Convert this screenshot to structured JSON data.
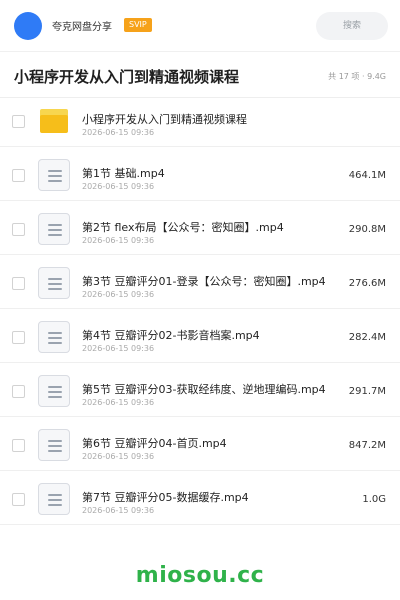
{
  "header": {
    "brand": "夸克网盘分享",
    "badge": "SVIP",
    "search_placeholder": "搜索"
  },
  "folder": {
    "title": "小程序开发从入门到精通视频课程",
    "meta": "共 17 项 · 9.4G"
  },
  "files": [
    {
      "name": "小程序开发从入门到精通视频课程",
      "date": "2026-06-15 09:36",
      "size": "",
      "type": "folder"
    },
    {
      "name": "第1节 基础.mp4",
      "date": "2026-06-15 09:36",
      "size": "464.1M",
      "type": "file"
    },
    {
      "name": "第2节 flex布局【公众号：密知圈】.mp4",
      "date": "2026-06-15 09:36",
      "size": "290.8M",
      "type": "file"
    },
    {
      "name": "第3节 豆瓣评分01-登录【公众号：密知圈】.mp4",
      "date": "2026-06-15 09:36",
      "size": "276.6M",
      "type": "file"
    },
    {
      "name": "第4节 豆瓣评分02-书影音档案.mp4",
      "date": "2026-06-15 09:36",
      "size": "282.4M",
      "type": "file"
    },
    {
      "name": "第5节 豆瓣评分03-获取经纬度、逆地理编码.mp4",
      "date": "2026-06-15 09:36",
      "size": "291.7M",
      "type": "file"
    },
    {
      "name": "第6节 豆瓣评分04-首页.mp4",
      "date": "2026-06-15 09:36",
      "size": "847.2M",
      "type": "file"
    },
    {
      "name": "第7节 豆瓣评分05-数据缓存.mp4",
      "date": "2026-06-15 09:36",
      "size": "1.0G",
      "type": "file"
    }
  ],
  "watermark": "miosou.cc",
  "colors": {
    "avatar": "#2f7bf6",
    "badge": "#f6a21a",
    "folder": "#f6be1a",
    "watermark": "#2fb24a"
  }
}
